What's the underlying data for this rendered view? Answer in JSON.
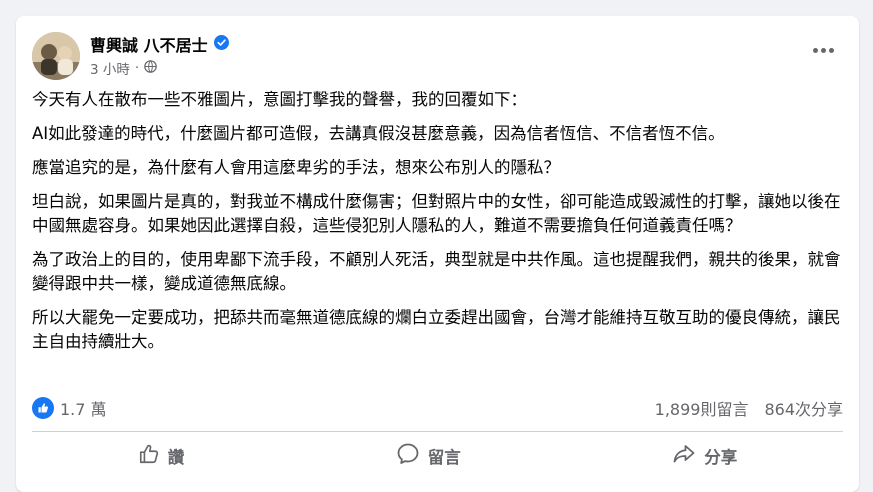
{
  "post": {
    "author": "曹興誠 八不居士",
    "time": "3 小時",
    "separator": "·",
    "paragraphs": [
      "今天有人在散布一些不雅圖片，意圖打擊我的聲譽，我的回覆如下：",
      "AI如此發達的時代，什麼圖片都可造假，去講真假沒甚麼意義，因為信者恆信、不信者恆不信。",
      "應當追究的是，為什麼有人會用這麼卑劣的手法，想來公布別人的隱私？",
      "坦白說，如果圖片是真的，對我並不構成什麼傷害；但對照片中的女性，卻可能造成毀滅性的打擊，讓她以後在中國無處容身。如果她因此選擇自殺，這些侵犯別人隱私的人，難道不需要擔負任何道義責任嗎？",
      "為了政治上的目的，使用卑鄙下流手段，不顧別人死活，典型就是中共作風。這也提醒我們，親共的後果，就會變得跟中共一樣，變成道德無底線。",
      "所以大罷免一定要成功，把舔共而毫無道德底線的爛白立委趕出國會，台灣才能維持互敬互助的優良傳統，讓民主自由持續壯大。"
    ]
  },
  "stats": {
    "reactions": "1.7 萬",
    "comments": "1,899則留言",
    "shares": "864次分享"
  },
  "actions": {
    "like": "讚",
    "comment": "留言",
    "share": "分享"
  },
  "colors": {
    "accent": "#1877f2",
    "secondary_text": "#65676b",
    "background": "#f0f2f5"
  },
  "icons": [
    "verified-badge-icon",
    "globe-icon",
    "more-icon",
    "like-reaction-icon",
    "thumbs-up-icon",
    "comment-bubble-icon",
    "share-arrow-icon"
  ]
}
